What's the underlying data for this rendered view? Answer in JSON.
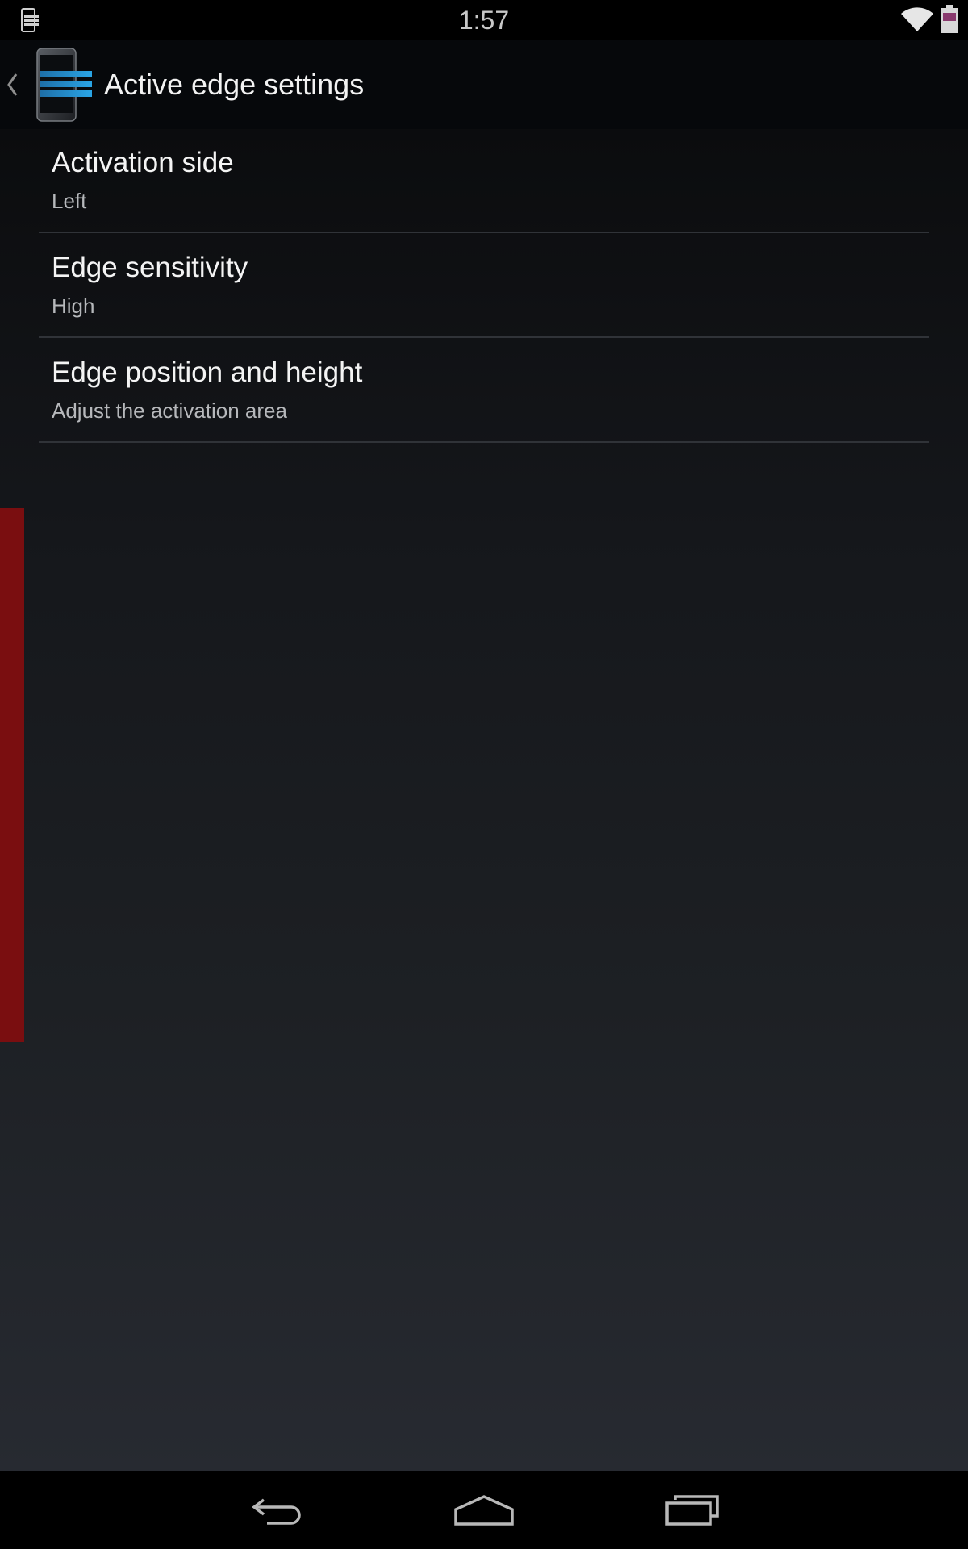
{
  "status_bar": {
    "time": "1:57",
    "notification_icon": "phone-settings-notification-icon",
    "wifi_icon": "wifi-signal-icon",
    "battery_icon": "battery-icon"
  },
  "action_bar": {
    "title": "Active edge settings",
    "up_icon": "chevron-left-icon",
    "app_icon": "phone-edge-app-icon",
    "accent_color": "#4a9fc3"
  },
  "preferences": [
    {
      "title": "Activation side",
      "summary": "Left"
    },
    {
      "title": "Edge sensitivity",
      "summary": "High"
    },
    {
      "title": "Edge position and height",
      "summary": "Adjust the activation area"
    }
  ],
  "edge_indicator": {
    "side": "left",
    "color": "#7a0e10"
  },
  "nav_bar": {
    "back_icon": "back-arrow-icon",
    "home_icon": "home-icon",
    "recents_icon": "recent-apps-icon"
  }
}
